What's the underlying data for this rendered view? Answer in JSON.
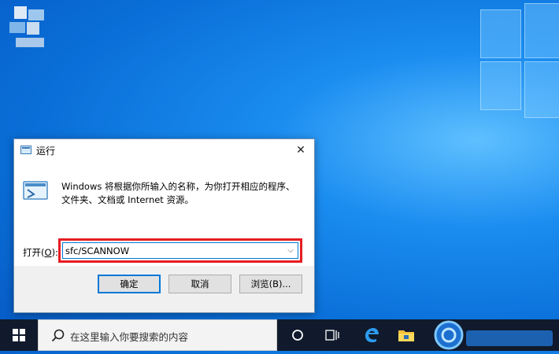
{
  "dialog": {
    "title": "运行",
    "description": "Windows 将根据你所输入的名称，为你打开相应的程序、文件夹、文档或 Internet 资源。",
    "open_label_prefix": "打开(",
    "open_label_key": "O",
    "open_label_suffix": "):",
    "command_value": "sfc/SCANNOW",
    "ok_label": "确定",
    "cancel_label": "取消",
    "browse_label": "浏览(B)..."
  },
  "taskbar": {
    "search_placeholder": "在这里输入你要搜索的内容"
  },
  "colors": {
    "accent": "#0078d7",
    "highlight": "#e51c23",
    "taskbar": "#101a2c"
  }
}
